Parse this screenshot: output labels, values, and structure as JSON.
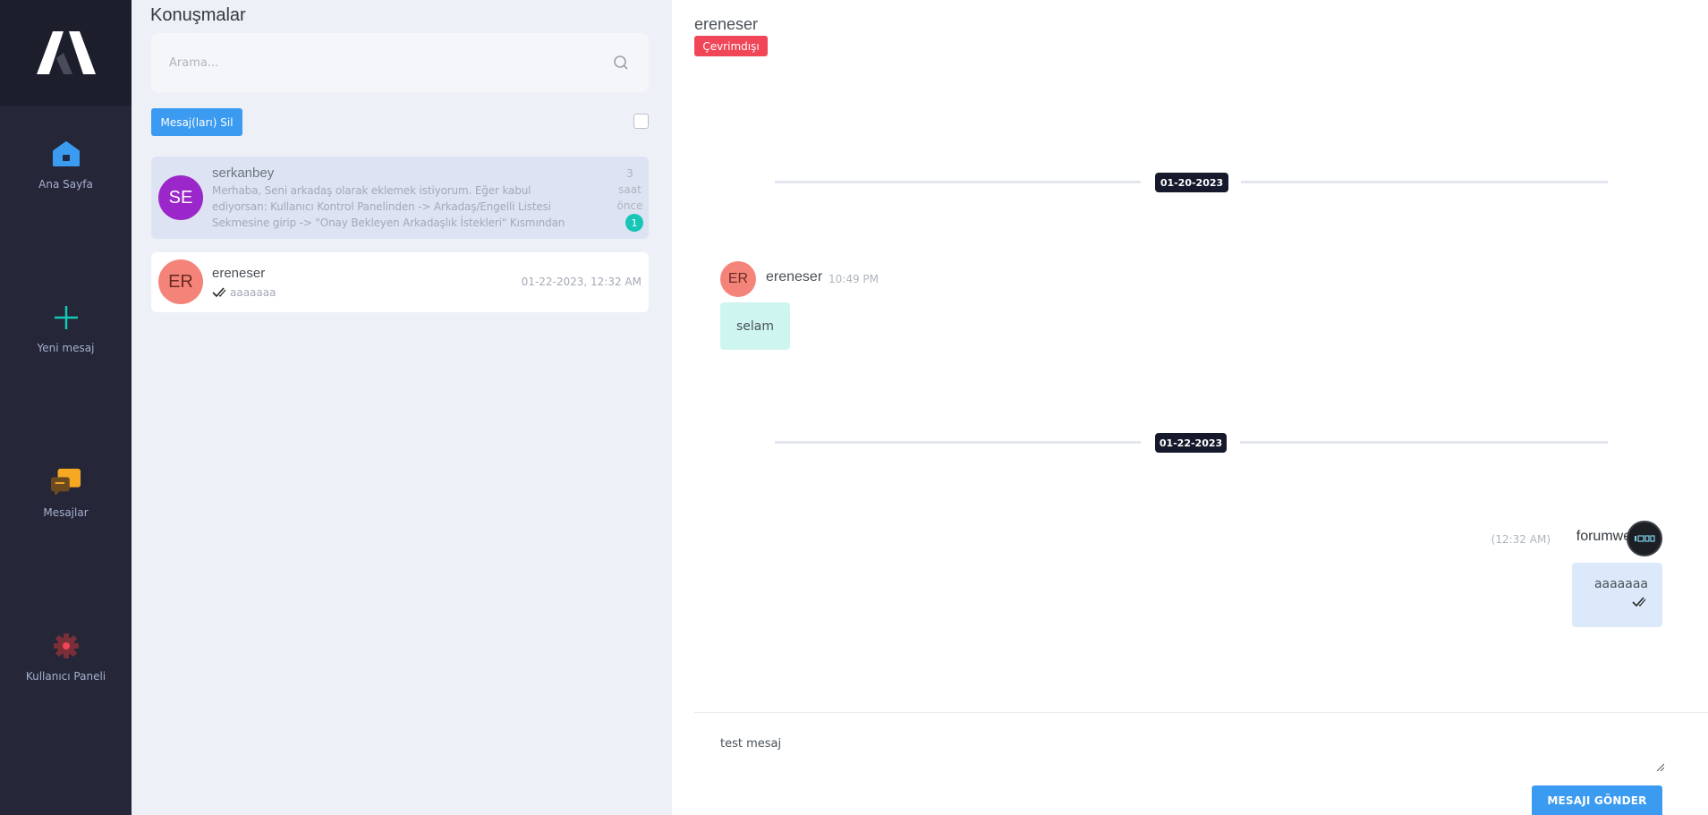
{
  "nav": {
    "items": [
      {
        "label": "Ana Sayfa",
        "icon": "home-icon"
      },
      {
        "label": "Yeni mesaj",
        "icon": "plus-icon"
      },
      {
        "label": "Mesajlar",
        "icon": "chat-bubbles-icon"
      },
      {
        "label": "Kullanıcı Paneli",
        "icon": "gear-icon"
      }
    ]
  },
  "list": {
    "title": "Konuşmalar",
    "search_placeholder": "Arama...",
    "delete_label": "Mesaj(ları) Sil",
    "conversations": [
      {
        "initials": "SE",
        "username": "serkanbey",
        "preview": "Merhaba, Seni arkadaş olarak eklemek istiyorum. Eğer kabul ediyorsan: Kullanıcı Kontrol Panelinden -> Arkadaş/Engelli Listesi Sekmesine girip -> \"Onay Bekleyen Arkadaşlık İstekleri\" Kısmından \"Kabul Et\" Bağlantısına Tıkla.",
        "time_lines": [
          "3",
          "saat",
          "önce"
        ],
        "unread": "1"
      },
      {
        "initials": "ER",
        "username": "ereneser",
        "last_message": "aaaaaaa",
        "date": "01-22-2023, 12:32 AM"
      }
    ]
  },
  "chat": {
    "username": "ereneser",
    "status": "Çevrimdışı",
    "date_dividers": [
      "01-20-2023",
      "01-22-2023"
    ],
    "incoming": {
      "initials": "ER",
      "name": "ereneser",
      "time": "10:49 PM",
      "text": "selam"
    },
    "outgoing": {
      "time": "(12:32 AM)",
      "name": "forumweb",
      "text": "aaaaaaa"
    },
    "compose_value": "test mesaj",
    "send_label": "MESAJI GÖNDER"
  },
  "colors": {
    "nav_bg": "#252637",
    "accent_blue": "#3b9bf0",
    "offline_red": "#f04657",
    "unread_teal": "#17c6b6",
    "avatar_purple": "#9b26c9",
    "avatar_salmon": "#f48479"
  }
}
